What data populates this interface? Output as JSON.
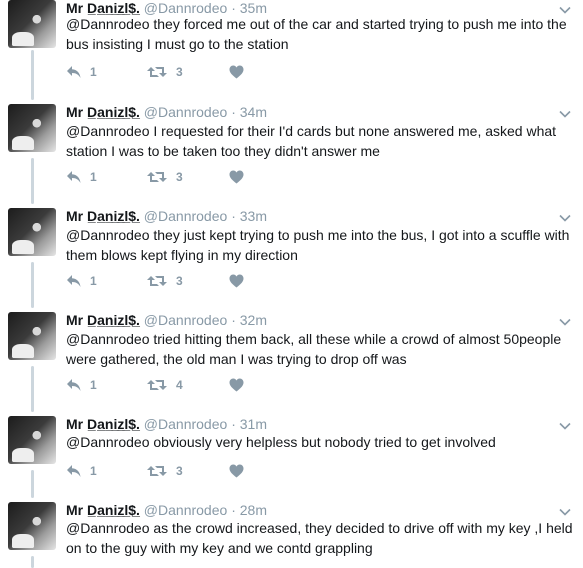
{
  "user": {
    "name": "Mr D̲a̲n̲i̲z̲l̲$̲.",
    "handle": "@Dannrodeo"
  },
  "tweets": [
    {
      "time": "35m",
      "text": "@Dannrodeo they forced me out of the car and started trying to push me into the bus insisting I must go to the station",
      "replies": "1",
      "retweets": "3"
    },
    {
      "time": "34m",
      "text": "@Dannrodeo I requested for their I'd cards but none answered me, asked what station I was to be taken too they didn't answer me",
      "replies": "1",
      "retweets": "3"
    },
    {
      "time": "33m",
      "text": "@Dannrodeo they just kept trying to push me into the bus, I got into a scuffle with them blows kept flying in my direction",
      "replies": "1",
      "retweets": "3"
    },
    {
      "time": "32m",
      "text": "@Dannrodeo tried hitting them back, all these while a crowd of almost 50people were gathered, the old man I was trying to drop off was",
      "replies": "1",
      "retweets": "4"
    },
    {
      "time": "31m",
      "text": "@Dannrodeo obviously very helpless but nobody tried to get involved",
      "replies": "1",
      "retweets": "3"
    },
    {
      "time": "28m",
      "text": "@Dannrodeo as the crowd increased, they decided to drive off with my key ,I held on to the guy with my key and we contd grappling",
      "replies": null,
      "retweets": null
    }
  ],
  "icons": {
    "reply": "reply-icon",
    "retweet": "retweet-icon",
    "like": "heart-icon",
    "more": "chevron-down-icon"
  },
  "colors": {
    "meta": "#8899a6",
    "thread": "#ccd6dd",
    "text": "#14171a"
  }
}
